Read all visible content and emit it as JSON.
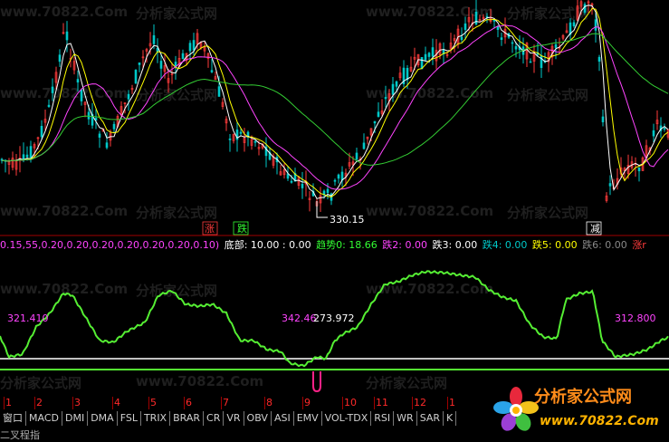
{
  "watermarks": [
    "www.70822.Com",
    "分析家公式网",
    "www.70822.Com",
    "分析家公式网",
    "www.70822.Com",
    "分析家公式网",
    "www.70822.Com",
    "分析家公式网",
    "www.70822.Com",
    "分析家公式网",
    "www.70822.Com",
    "分析家公式网"
  ],
  "price_chart": {
    "low_label": "330.15",
    "signals": [
      {
        "text": "涨",
        "color": "#ff3b3b"
      },
      {
        "text": "跌",
        "color": "#33ff33"
      },
      {
        "text": "减",
        "color": "#ffffff"
      }
    ]
  },
  "indicator_params": {
    "params_text": "0.15,55,0.20,0.20,0.20,0.20,0.20,0.20,0.10)",
    "bottom": "底部: 10.00 : 0.00",
    "trend": "趋势0: 18.66",
    "down2": "跌2: 0.00",
    "down3": "跌3: 0.00",
    "down4": "跌4: 0.00",
    "down5": "跌5: 0.00",
    "down6": "跌6: 0.00",
    "up_r": "涨r"
  },
  "indicator_chart": {
    "values_left": "321.410",
    "values_mid1": "342.46",
    "values_mid2": "273.972",
    "values_right": "312.800"
  },
  "number_row": [
    "1",
    "2",
    "3",
    "4",
    "5",
    "6",
    "7",
    "8",
    "9",
    "10",
    "11",
    "12",
    "1"
  ],
  "tabs": [
    "窗口",
    "MACD",
    "DMI",
    "DMA",
    "FSL",
    "TRIX",
    "BRAR",
    "CR",
    "VR",
    "OBV",
    "ASI",
    "EMV",
    "VOL-TDX",
    "RSI",
    "WR",
    "SAR",
    "K"
  ],
  "bottom_text": "二叉程指",
  "logo": {
    "title": "分析家公式网",
    "url": "www.70822.Com"
  },
  "colors": {
    "up": "#ff3b3b",
    "down": "#00c8c8",
    "ma5": "#ffffff",
    "ma10": "#ffff00",
    "ma20": "#ff44ff",
    "ma60": "#33cc33",
    "indicator": "#55ee33"
  }
}
